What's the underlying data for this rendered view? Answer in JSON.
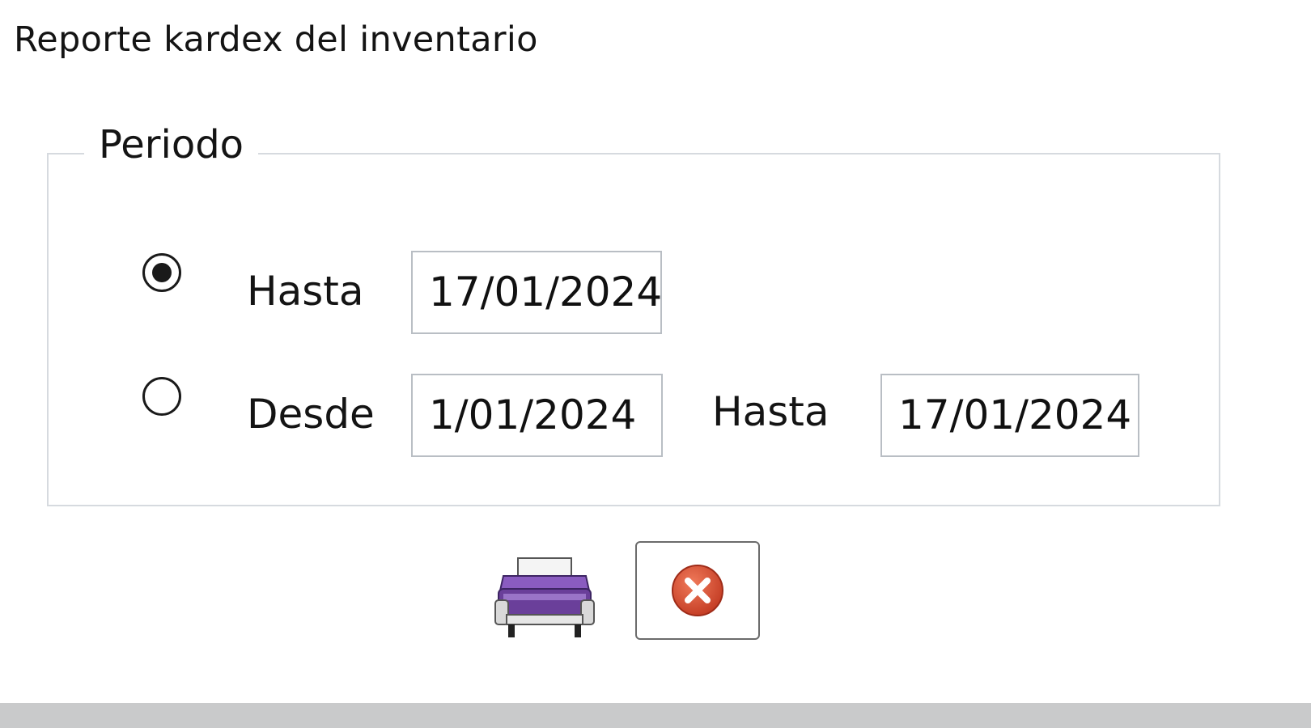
{
  "window": {
    "title": "Reporte kardex del inventario"
  },
  "periodo": {
    "legend": "Periodo",
    "option_hasta": {
      "checked": true,
      "label": "Hasta",
      "date": "17/01/2024"
    },
    "option_rango": {
      "checked": false,
      "desde_label": "Desde",
      "desde_date": "1/01/2024",
      "hasta_label": "Hasta",
      "hasta_date": "17/01/2024"
    }
  },
  "actions": {
    "print_icon": "printer-icon",
    "close_icon": "close-circle-icon"
  },
  "colors": {
    "printer_body": "#6a3f9a",
    "close_red": "#d0462e",
    "border": "#d6dadf"
  }
}
